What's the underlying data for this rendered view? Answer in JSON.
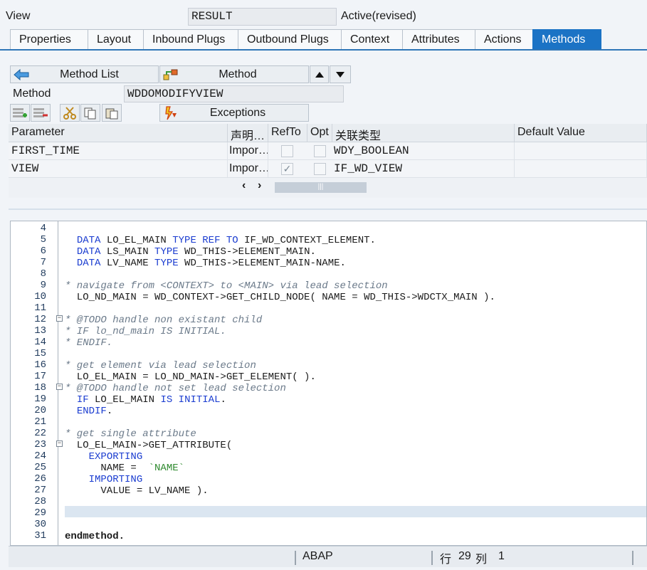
{
  "header": {
    "view_label": "View",
    "view_name": "RESULT",
    "status": "Active(revised)"
  },
  "tabs": [
    {
      "label": "Properties"
    },
    {
      "label": "Layout"
    },
    {
      "label": "Inbound Plugs"
    },
    {
      "label": "Outbound Plugs"
    },
    {
      "label": "Context"
    },
    {
      "label": "Attributes"
    },
    {
      "label": "Actions"
    },
    {
      "label": "Methods"
    }
  ],
  "active_tab": "Methods",
  "method_nav": {
    "method_list_label": "Method List",
    "method_label": "Method"
  },
  "method_field": {
    "label": "Method",
    "value": "WDDOMODIFYVIEW"
  },
  "toolbar": {
    "exceptions_label": "Exceptions"
  },
  "param_table": {
    "headers": [
      "Parameter",
      "声明…",
      "RefTo",
      "Opt",
      "关联类型",
      "Default Value"
    ],
    "rows": [
      {
        "parameter": "FIRST_TIME",
        "declaration": "Impor…",
        "refto": false,
        "opt": false,
        "type": "WDY_BOOLEAN",
        "default": ""
      },
      {
        "parameter": "VIEW",
        "declaration": "Impor…",
        "refto": true,
        "opt": false,
        "type": "IF_WD_VIEW",
        "default": ""
      }
    ]
  },
  "code": {
    "lines": [
      {
        "n": "4",
        "text": ""
      },
      {
        "n": "5",
        "text": "  DATA LO_EL_MAIN TYPE REF TO IF_WD_CONTEXT_ELEMENT."
      },
      {
        "n": "6",
        "text": "  DATA LS_MAIN TYPE WD_THIS->ELEMENT_MAIN."
      },
      {
        "n": "7",
        "text": "  DATA LV_NAME TYPE WD_THIS->ELEMENT_MAIN-NAME."
      },
      {
        "n": "8",
        "text": ""
      },
      {
        "n": "9",
        "text": "* navigate from <CONTEXT> to <MAIN> via lead selection"
      },
      {
        "n": "10",
        "text": "  LO_ND_MAIN = WD_CONTEXT->GET_CHILD_NODE( NAME = WD_THIS->WDCTX_MAIN )."
      },
      {
        "n": "11",
        "text": ""
      },
      {
        "n": "12",
        "text": "* @TODO handle non existant child"
      },
      {
        "n": "13",
        "text": "* IF lo_nd_main IS INITIAL."
      },
      {
        "n": "14",
        "text": "* ENDIF."
      },
      {
        "n": "15",
        "text": ""
      },
      {
        "n": "16",
        "text": "* get element via lead selection"
      },
      {
        "n": "17",
        "text": "  LO_EL_MAIN = LO_ND_MAIN->GET_ELEMENT( )."
      },
      {
        "n": "18",
        "text": "* @TODO handle not set lead selection"
      },
      {
        "n": "19",
        "text": "  IF LO_EL_MAIN IS INITIAL."
      },
      {
        "n": "20",
        "text": "  ENDIF."
      },
      {
        "n": "21",
        "text": ""
      },
      {
        "n": "22",
        "text": "* get single attribute"
      },
      {
        "n": "23",
        "text": "  LO_EL_MAIN->GET_ATTRIBUTE("
      },
      {
        "n": "24",
        "text": "    EXPORTING"
      },
      {
        "n": "25",
        "text": "      NAME =  `NAME`"
      },
      {
        "n": "26",
        "text": "    IMPORTING"
      },
      {
        "n": "27",
        "text": "      VALUE = LV_NAME )."
      },
      {
        "n": "28",
        "text": ""
      },
      {
        "n": "29",
        "text": ""
      },
      {
        "n": "30",
        "text": ""
      },
      {
        "n": "31",
        "text": "endmethod."
      }
    ]
  },
  "status_bar": {
    "language": "ABAP",
    "row_label": "行",
    "row_value": "29",
    "col_label": "列",
    "col_value": "1"
  }
}
